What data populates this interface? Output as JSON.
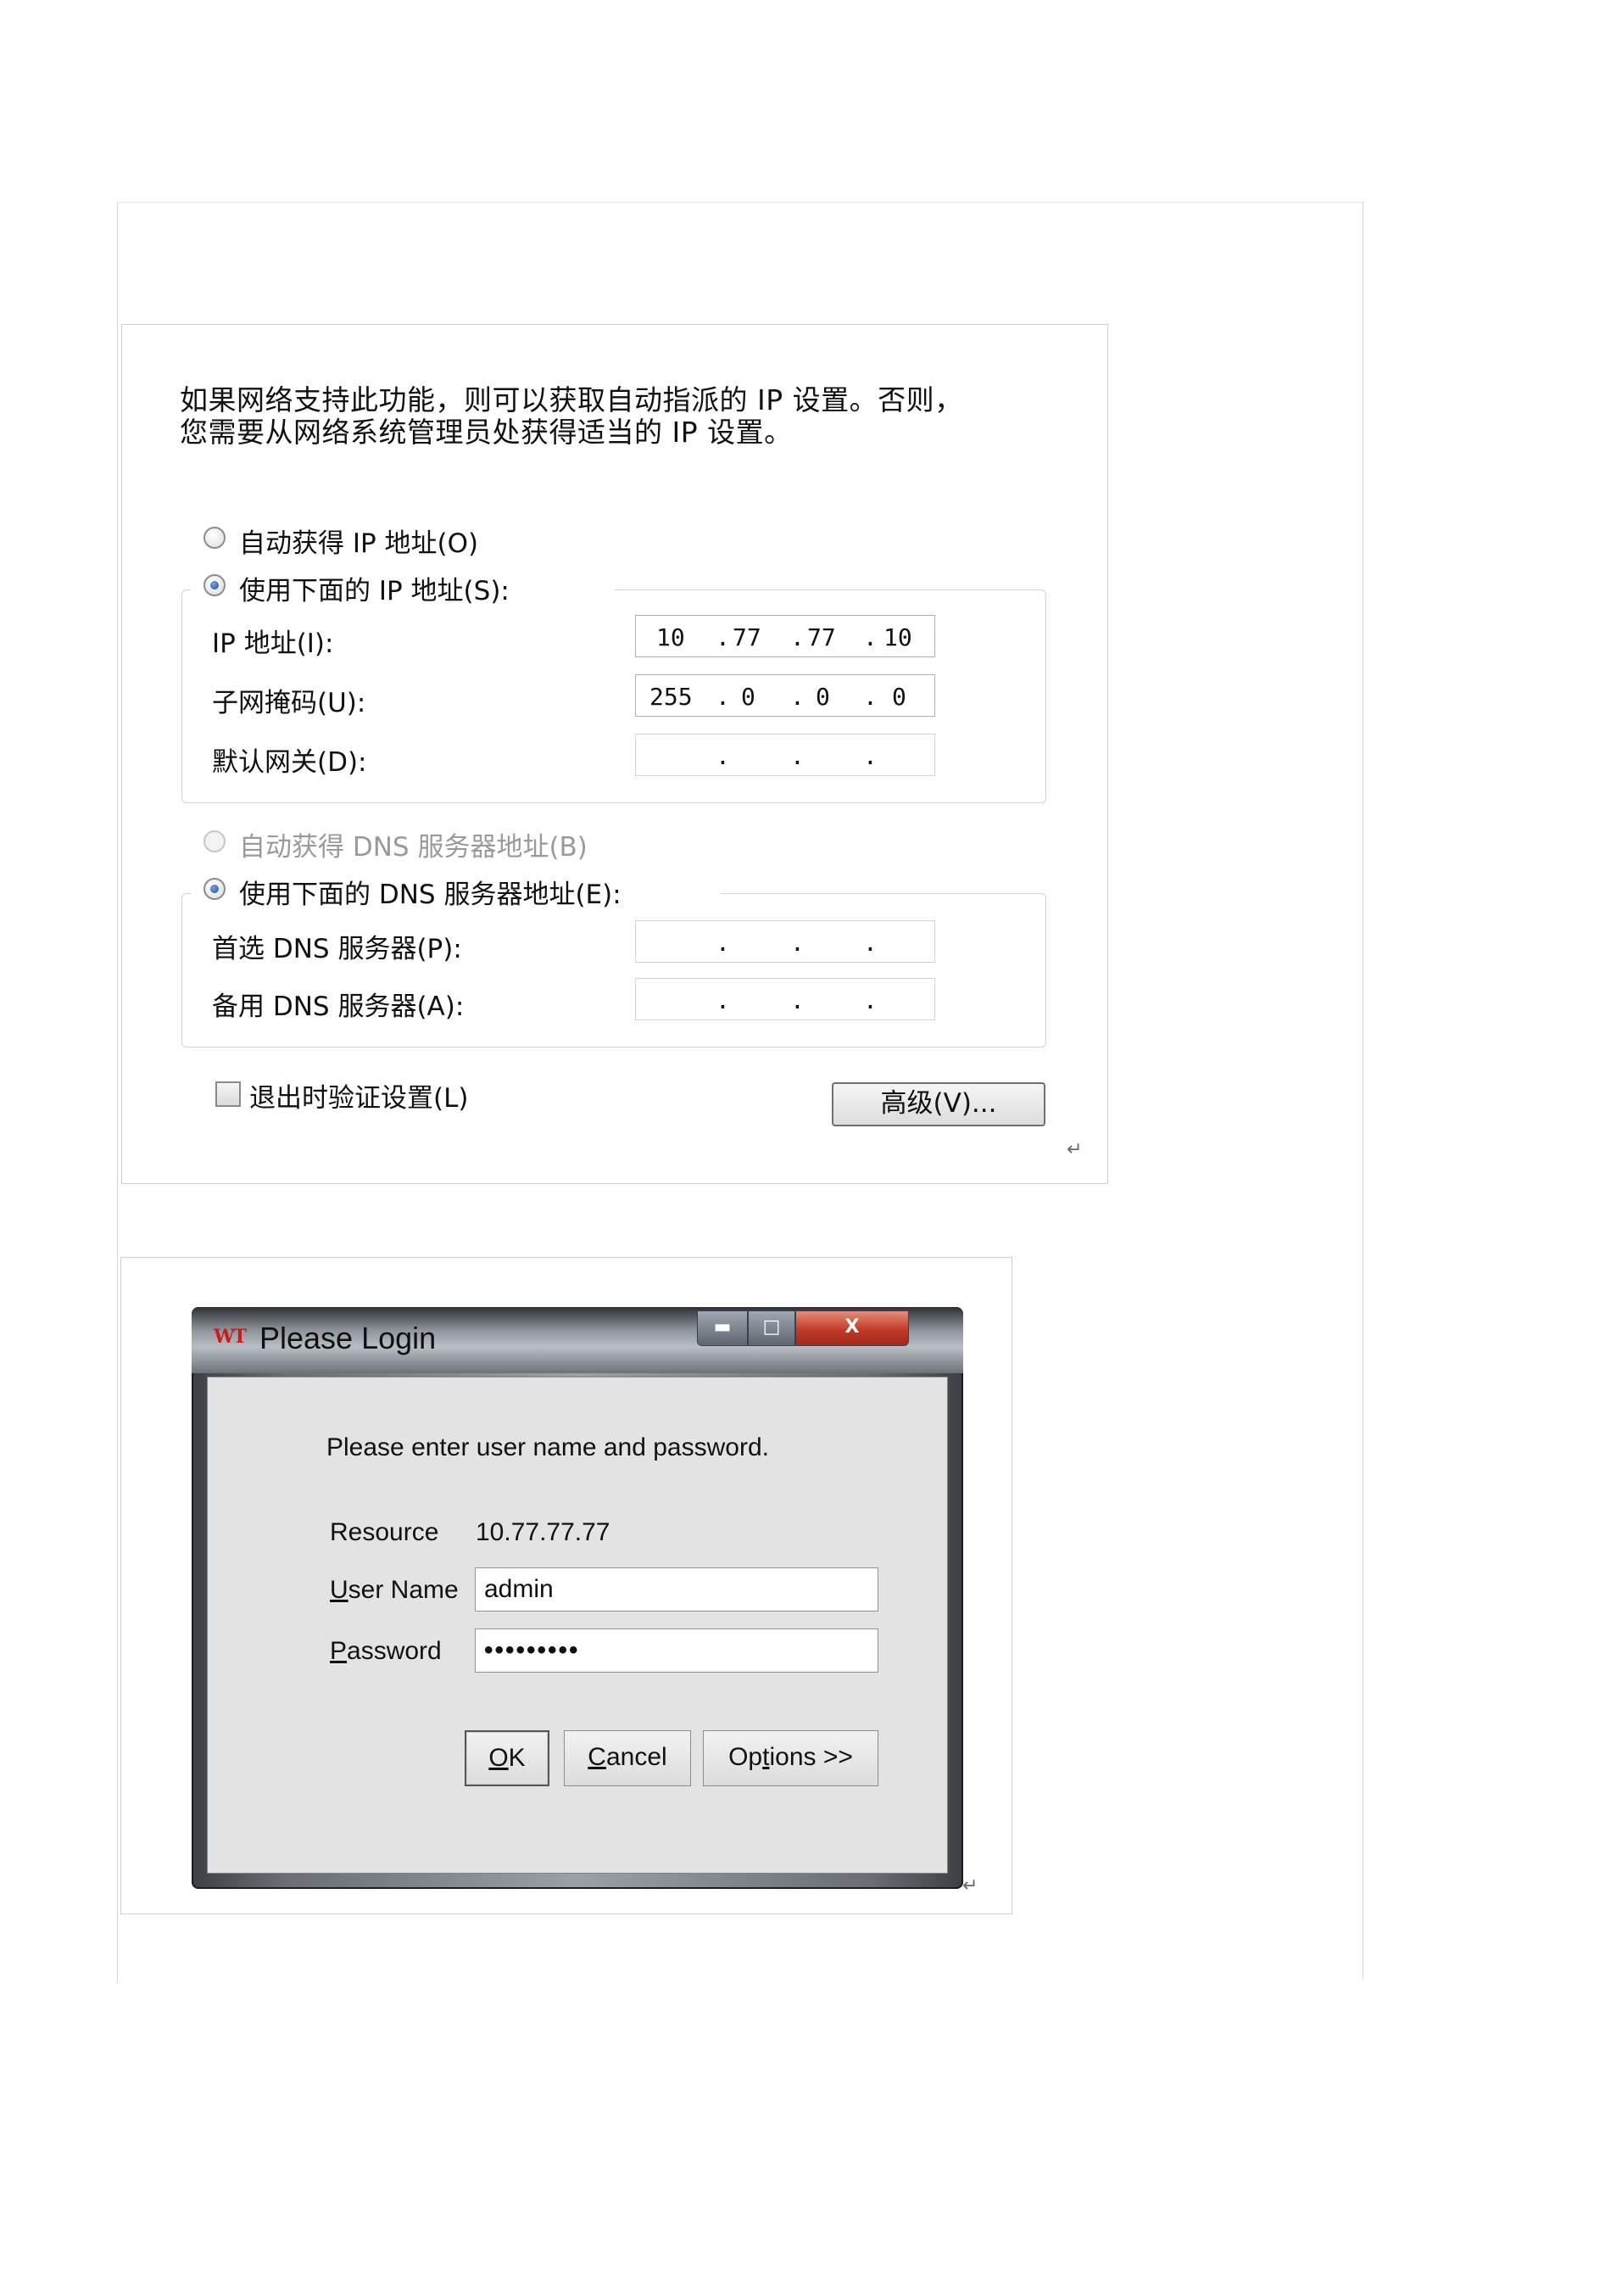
{
  "ip_dialog": {
    "intro_line1": "如果网络支持此功能，则可以获取自动指派的 IP 设置。否则，",
    "intro_line2": "您需要从网络系统管理员处获得适当的 IP 设置。",
    "auto_ip_label": "自动获得 IP 地址(O)",
    "manual_ip_label": "使用下面的 IP 地址(S):",
    "ip_address_label": "IP 地址(I):",
    "ip_address": [
      "10",
      "77",
      "77",
      "10"
    ],
    "subnet_label": "子网掩码(U):",
    "subnet_mask": [
      "255",
      "0",
      "0",
      "0"
    ],
    "gateway_label": "默认网关(D):",
    "auto_dns_label": "自动获得 DNS 服务器地址(B)",
    "manual_dns_label": "使用下面的 DNS 服务器地址(E):",
    "preferred_dns_label": "首选 DNS 服务器(P):",
    "alternate_dns_label": "备用 DNS 服务器(A):",
    "validate_label": "退出时验证设置(L)",
    "advanced_button": "高级(V)...",
    "ip_selected_option": "manual",
    "dns_selected_option": "manual"
  },
  "login_dialog": {
    "title": "Please Login",
    "logo_text": "WT",
    "minimize_symbol": "▬",
    "maximize_symbol": "□",
    "close_symbol": "X",
    "prompt": "Please enter user name and password.",
    "resource_label": "Resource",
    "resource_value": "10.77.77.77",
    "username_label_u": "U",
    "username_label_rest": "ser Name",
    "username_value": "admin",
    "password_label_p": "P",
    "password_label_rest": "assword",
    "password_mask": "•••••••••",
    "ok_u": "O",
    "ok_rest": "K",
    "cancel_u": "C",
    "cancel_rest": "ancel",
    "options_pre": "Op",
    "options_u": "t",
    "options_rest": "ions >>"
  },
  "paragraph_mark": "↵"
}
